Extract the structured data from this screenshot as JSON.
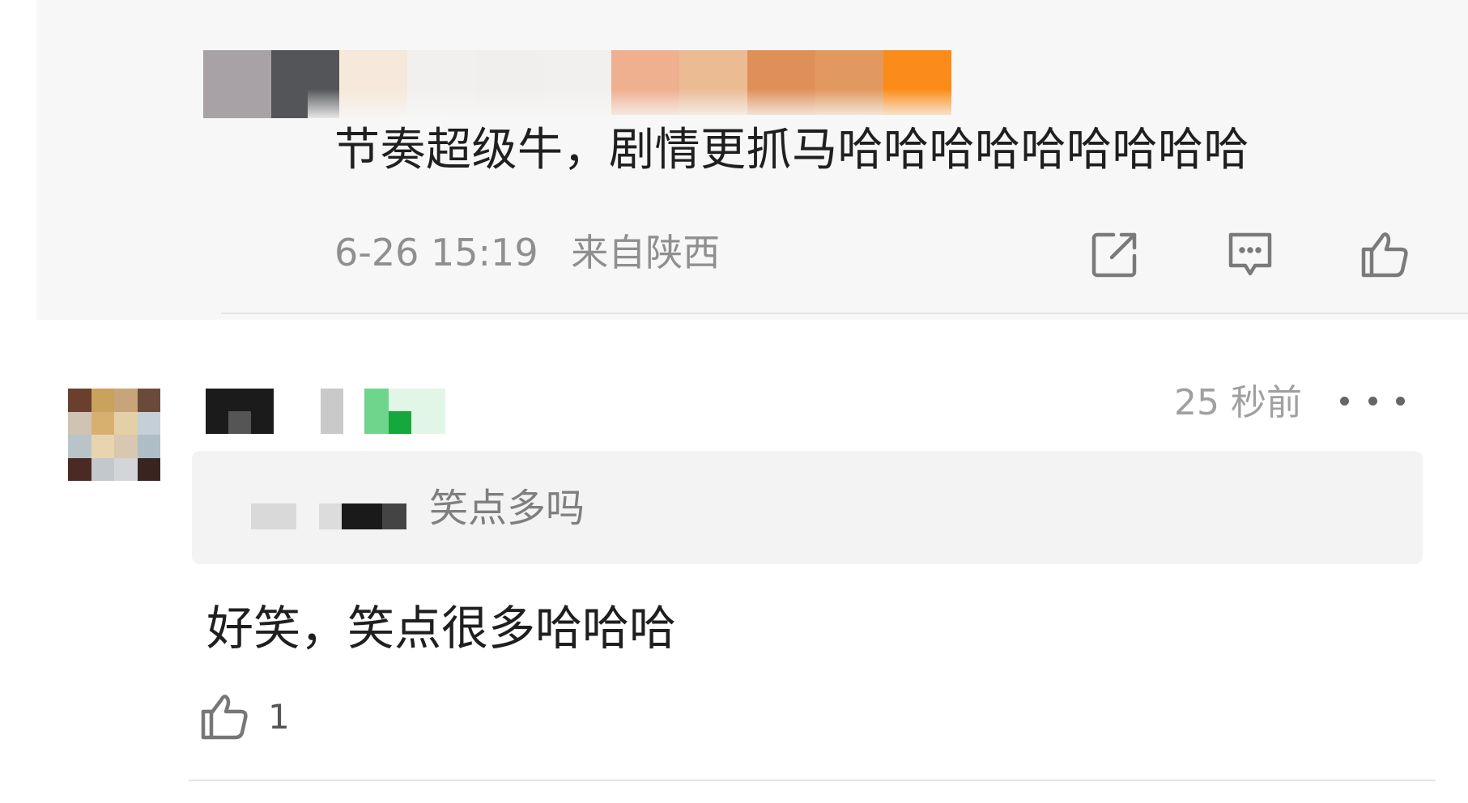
{
  "top_comment": {
    "text": "节奏超级牛，剧情更抓马哈哈哈哈哈哈哈哈哈",
    "date": "6-26 15:19",
    "location": "来自陕西",
    "actions": {
      "share_icon": "share-icon",
      "comment_icon": "comment-icon",
      "like_icon": "thumbs-up-icon"
    }
  },
  "reply": {
    "time": "25 秒前",
    "more_icon": "more-icon",
    "quoted_text": "笑点多吗",
    "text": "好笑，笑点很多哈哈哈",
    "like_count": "1",
    "like_icon": "thumbs-up-icon"
  },
  "colors": {
    "background": "#ffffff",
    "comment_bg": "#f7f7f7",
    "quote_bg": "#f3f3f3",
    "text": "#1f1f1f",
    "meta_text": "#8f8f8f",
    "divider": "#e4e4e4"
  }
}
